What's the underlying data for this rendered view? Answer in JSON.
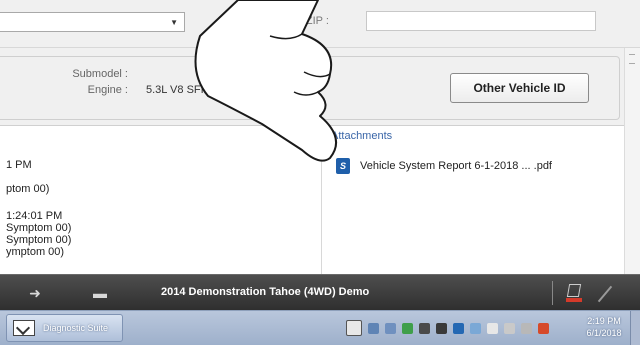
{
  "form": {
    "dropdown_value": "",
    "postcode_label": "stCode/ZIP :",
    "postcode_value": ""
  },
  "vehicle": {
    "submodel_label": "Submodel :",
    "engine_label": "Engine :",
    "engine_value": "5.3L V8 SFI (LM",
    "other_vehicle_button": "Other Vehicle ID"
  },
  "log_lines": [
    "1 PM",
    "ptom 00)",
    "1:24:01 PM",
    "Symptom 00)",
    " Symptom 00)",
    "ymptom 00)"
  ],
  "attachments": {
    "title": "Attachments",
    "items": [
      {
        "icon": "pdf-report-icon",
        "name": "Vehicle System Report 6-1-2018 ... .pdf"
      }
    ]
  },
  "toolbar": {
    "title": "2014 Demonstration Tahoe (4WD) Demo",
    "icons": [
      "send-arrow-icon",
      "folder-icon",
      "print-icon",
      "pen-icon"
    ],
    "accent_color": "#d43a2a"
  },
  "taskbar": {
    "app_label": "Diagnostic Suite",
    "clock_time": "2:19 PM",
    "clock_date": "6/1/2018",
    "tray_icons": [
      "flag-icon",
      "network-icon",
      "volume-icon",
      "security-icon",
      "printer-icon",
      "bluetooth-icon",
      "app-icon",
      "flag-icon",
      "wifi-icon",
      "signal-icon",
      "speaker-icon"
    ]
  }
}
